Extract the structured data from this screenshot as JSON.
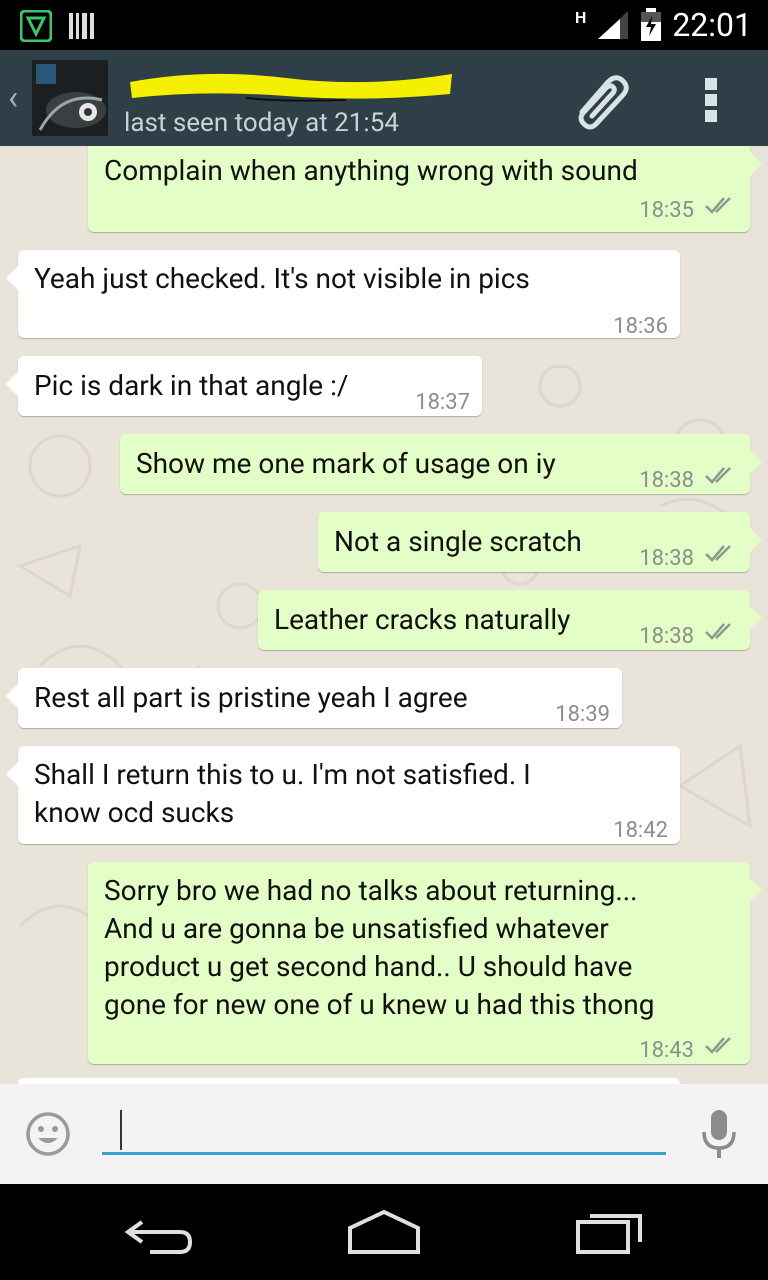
{
  "status_bar": {
    "time": "22:01",
    "network": "H"
  },
  "header": {
    "contact_name": "",
    "last_seen": "last seen today at 21:54"
  },
  "messages": [
    {
      "direction": "out",
      "text": "Complain when anything wrong with sound",
      "time": "18:35",
      "ticks": true
    },
    {
      "direction": "in",
      "text": "Yeah just checked. It's not visible in pics",
      "time": "18:36"
    },
    {
      "direction": "in",
      "text": "Pic is dark in that angle :/",
      "time": "18:37"
    },
    {
      "direction": "out",
      "text": "Show me one mark of usage on iy",
      "time": "18:38",
      "ticks": true
    },
    {
      "direction": "out",
      "text": "Not a single scratch",
      "time": "18:38",
      "ticks": true
    },
    {
      "direction": "out",
      "text": "Leather cracks naturally",
      "time": "18:38",
      "ticks": true
    },
    {
      "direction": "in",
      "text": "Rest all part is pristine yeah I agree",
      "time": "18:39"
    },
    {
      "direction": "in",
      "text": "Shall I return this to u. I'm not satisfied. I\nknow ocd sucks",
      "time": "18:42"
    },
    {
      "direction": "out",
      "text": "Sorry bro we had no talks about returning...\nAnd u are gonna be unsatisfied whatever\nproduct u get second hand.. U should have\ngone for new one of u knew u had this thong",
      "time": "18:43",
      "ticks": true
    }
  ],
  "input": {
    "value": "",
    "placeholder": ""
  },
  "colors": {
    "action_bar": "#2e3f48",
    "outgoing_bubble": "#e3fec6",
    "incoming_bubble": "#ffffff",
    "chat_background": "#e9e4da",
    "input_underline": "#3aa0d8"
  },
  "icons": {
    "status_left": [
      "shield-app-icon",
      "barcode-icon"
    ],
    "header": [
      "back-chevron-icon",
      "attach-paperclip-icon",
      "overflow-menu-icon"
    ],
    "input": [
      "emoji-icon",
      "microphone-icon"
    ],
    "nav": [
      "back-nav-icon",
      "home-nav-icon",
      "recents-nav-icon"
    ]
  }
}
